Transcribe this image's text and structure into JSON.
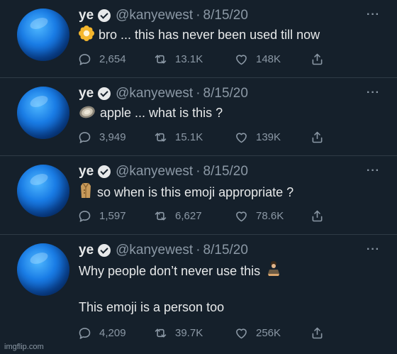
{
  "tweets": [
    {
      "name": "ye",
      "handle": "@kanyewest",
      "separator": "·",
      "date": "8/15/20",
      "emoji_icon": "blossom-emoji",
      "text": "bro ... this has never been used till now",
      "text2": "",
      "replies": "2,654",
      "retweets": "13.1K",
      "likes": "148K"
    },
    {
      "name": "ye",
      "handle": "@kanyewest",
      "separator": "·",
      "date": "8/15/20",
      "emoji_icon": "oyster-emoji",
      "text": "apple ... what is this ?",
      "text2": "",
      "replies": "3,949",
      "retweets": "15.1K",
      "likes": "139K"
    },
    {
      "name": "ye",
      "handle": "@kanyewest",
      "separator": "·",
      "date": "8/15/20",
      "emoji_icon": "coat-emoji",
      "text": "so when is this emoji appropriate ?",
      "text2": "",
      "replies": "1,597",
      "retweets": "6,627",
      "likes": "78.6K"
    },
    {
      "name": "ye",
      "handle": "@kanyewest",
      "separator": "·",
      "date": "8/15/20",
      "emoji_icon": "person-in-lotus-emoji",
      "text": "Why people don’t never use this",
      "text2": "This emoji is a person too",
      "replies": "4,209",
      "retweets": "39.7K",
      "likes": "256K"
    }
  ],
  "more_label": "···",
  "watermark": "imgflip.com",
  "colors": {
    "background": "#15202b",
    "text": "#e7e9ea",
    "muted": "#8b98a5",
    "divider": "#2f3b46",
    "avatar": "#1a7de6"
  }
}
